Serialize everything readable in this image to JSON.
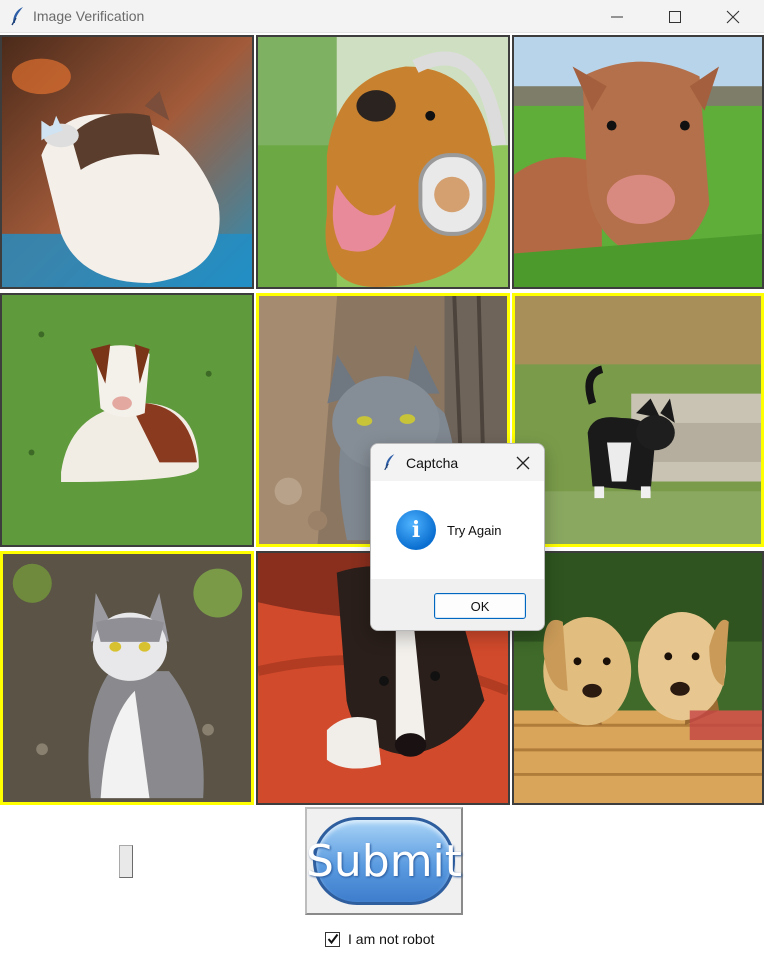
{
  "window": {
    "title": "Image Verification"
  },
  "grid": {
    "images": [
      {
        "subject": "cat with butterfly",
        "selected": true
      },
      {
        "subject": "dog with headphones",
        "selected": false
      },
      {
        "subject": "brown calf in grass",
        "selected": false
      },
      {
        "subject": "calf lying on grass",
        "selected": false
      },
      {
        "subject": "grey cat by tree",
        "selected": true
      },
      {
        "subject": "black and white cat walking",
        "selected": true
      },
      {
        "subject": "grey and white cat sitting",
        "selected": true
      },
      {
        "subject": "dog lying on red cloth",
        "selected": false
      },
      {
        "subject": "two golden puppies in basket",
        "selected": false
      }
    ]
  },
  "controls": {
    "submit_label": "Submit",
    "robot_label": "I am not robot",
    "robot_checked": true
  },
  "dialog": {
    "title": "Captcha",
    "message": "Try Again",
    "ok_label": "OK",
    "icon": "info-icon"
  },
  "colors": {
    "selected_border": "#ffff00",
    "submit_accent": "#5b9be0",
    "info_blue": "#0a6fd0"
  }
}
